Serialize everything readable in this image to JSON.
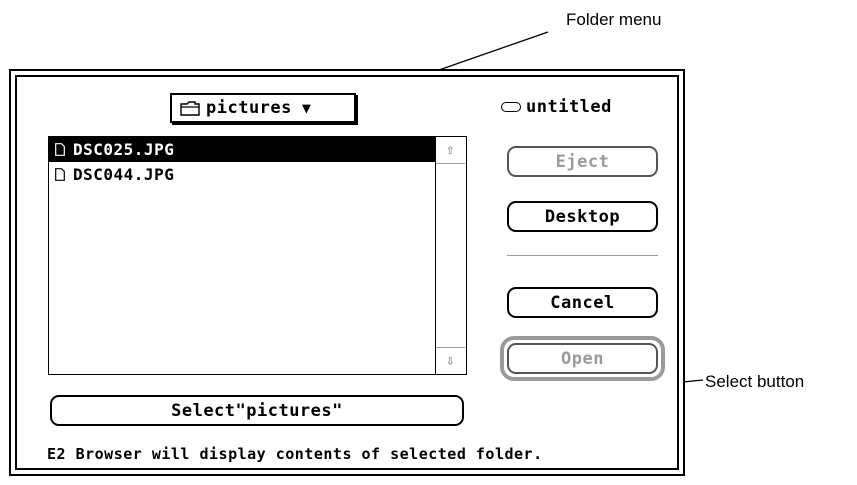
{
  "annotations": {
    "folder_menu": "Folder menu",
    "select_button": "Select button"
  },
  "folder_popup": {
    "label": "pictures",
    "icon": "folder-icon"
  },
  "disk": {
    "label": "untitled",
    "icon": "disk-icon"
  },
  "files": [
    {
      "name": "DSC025.JPG",
      "selected": true,
      "icon": "document-icon"
    },
    {
      "name": "DSC044.JPG",
      "selected": false,
      "icon": "document-icon"
    }
  ],
  "buttons": {
    "eject": "Eject",
    "desktop": "Desktop",
    "cancel": "Cancel",
    "open": "Open",
    "select": "Select\"pictures\""
  },
  "status_text": "E2 Browser will display contents of selected folder."
}
